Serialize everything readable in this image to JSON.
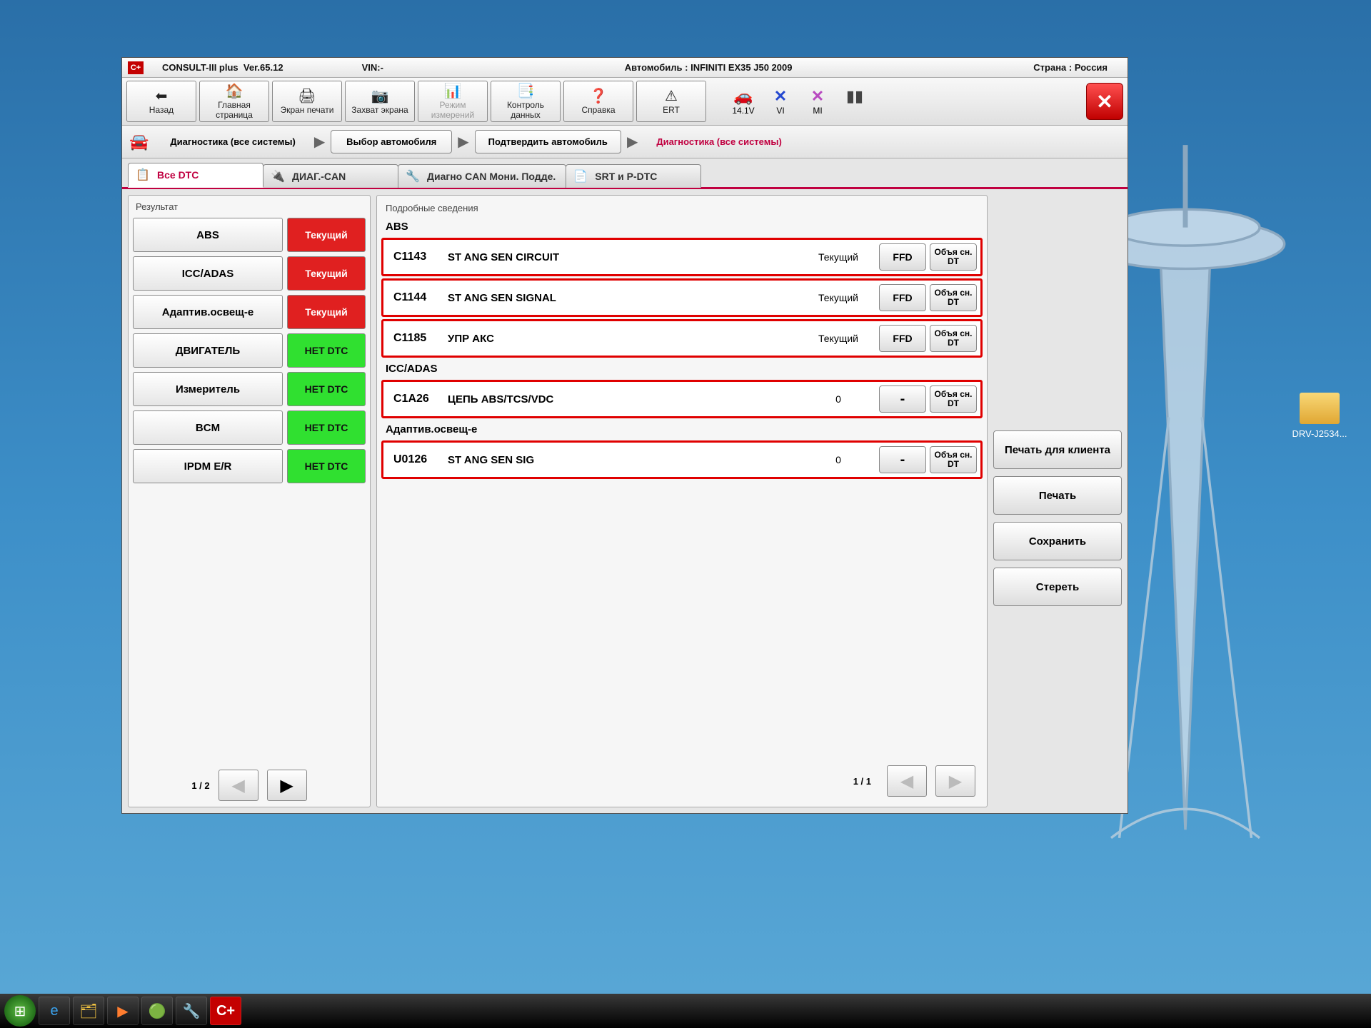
{
  "titlebar": {
    "app_name": "CONSULT-III plus",
    "version": "Ver.65.12",
    "vin_label": "VIN:-",
    "vehicle_label": "Автомобиль : INFINITI EX35 J50 2009",
    "country_label": "Страна : Россия"
  },
  "toolbar": {
    "back": "Назад",
    "home": "Главная страница",
    "print": "Экран печати",
    "capture": "Захват экрана",
    "mode": "Режим измерений",
    "recdata": "Контроль данных",
    "help": "Справка",
    "ert": "ERT"
  },
  "status": {
    "voltage": "14.1V",
    "vi": "VI",
    "mi": "MI"
  },
  "breadcrumb": {
    "s0": "Диагностика (все системы)",
    "s1": "Выбор автомобиля",
    "s2": "Подтвердить автомобиль",
    "s3": "Диагностика (все системы)"
  },
  "tabs": {
    "t0": "Все DTC",
    "t1": "ДИАГ.-CAN",
    "t2": "Диагно CAN Мони. Подде.",
    "t3": "SRT и P-DTC"
  },
  "leftpanel": {
    "title": "Результат",
    "systems": [
      {
        "name": "ABS",
        "status": "Текущий",
        "status_kind": "current"
      },
      {
        "name": "ICC/ADAS",
        "status": "Текущий",
        "status_kind": "current"
      },
      {
        "name": "Адаптив.освещ-е",
        "status": "Текущий",
        "status_kind": "current"
      },
      {
        "name": "ДВИГАТЕЛЬ",
        "status": "НЕТ DTC",
        "status_kind": "none"
      },
      {
        "name": "Измеритель",
        "status": "НЕТ DTC",
        "status_kind": "none"
      },
      {
        "name": "BCM",
        "status": "НЕТ DTC",
        "status_kind": "none"
      },
      {
        "name": "IPDM E/R",
        "status": "НЕТ DTC",
        "status_kind": "none"
      }
    ],
    "page": "1 / 2"
  },
  "details": {
    "title": "Подробные сведения",
    "ffd_label": "FFD",
    "exp_label": "Объя сн. DT",
    "groups": [
      {
        "name": "ABS",
        "rows": [
          {
            "code": "C1143",
            "desc": "ST ANG SEN CIRCUIT",
            "status": "Текущий",
            "ffd": "FFD"
          },
          {
            "code": "C1144",
            "desc": "ST ANG SEN SIGNAL",
            "status": "Текущий",
            "ffd": "FFD"
          },
          {
            "code": "C1185",
            "desc": "УПР АКС",
            "status": "Текущий",
            "ffd": "FFD"
          }
        ]
      },
      {
        "name": "ICC/ADAS",
        "rows": [
          {
            "code": "C1A26",
            "desc": "ЦЕПЬ ABS/TCS/VDC",
            "status": "0",
            "ffd": "-"
          }
        ]
      },
      {
        "name": "Адаптив.освещ-е",
        "rows": [
          {
            "code": "U0126",
            "desc": "ST ANG SEN SIG",
            "status": "0",
            "ffd": "-"
          }
        ]
      }
    ],
    "page": "1 / 1"
  },
  "actions": {
    "print_client": "Печать для клиента",
    "print": "Печать",
    "save": "Сохранить",
    "erase": "Стереть"
  },
  "desktop": {
    "folder": "DRV-J2534..."
  }
}
